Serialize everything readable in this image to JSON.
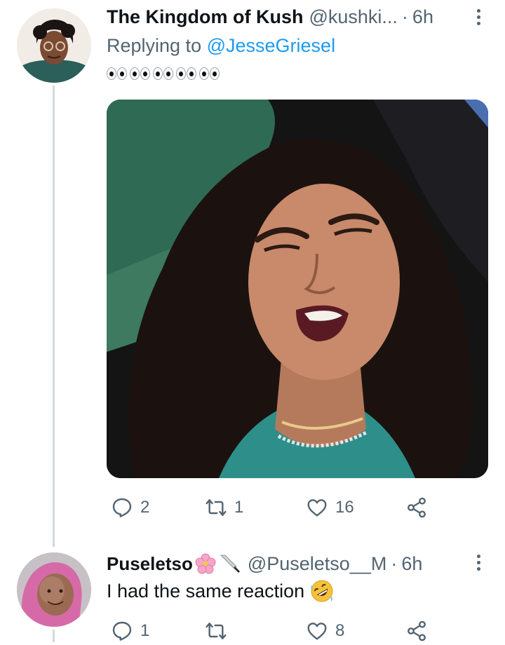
{
  "tweets": [
    {
      "author_name": "The Kingdom of Kush",
      "handle": "@kushki...",
      "separator": "·",
      "time": "6h",
      "replying_prefix": "Replying to",
      "replying_to": "@JesseGriesel",
      "body_emoji": "👀👀👀👀👀",
      "stats": {
        "replies": "2",
        "retweets": "1",
        "likes": "16"
      }
    },
    {
      "author_name": "Puseletso",
      "name_emojis": "🌸🔪",
      "handle": "@Puseletso__M",
      "separator": "·",
      "time": "6h",
      "text": "I had the same reaction",
      "text_emoji": "🤣",
      "stats": {
        "replies": "1",
        "retweets": "",
        "likes": "8"
      }
    }
  ],
  "colors": {
    "text_primary": "#0f1419",
    "text_secondary": "#536471",
    "link": "#1d9bf0",
    "thread_line": "#cfd9de"
  }
}
